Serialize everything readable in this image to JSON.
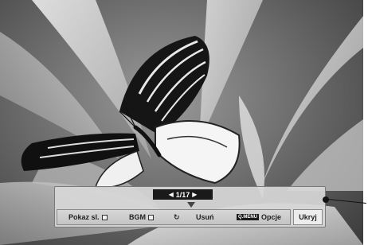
{
  "osd": {
    "page_counter": "1/17",
    "prev_arrow": "◀",
    "next_arrow": "▶",
    "buttons": {
      "slideshow": "Pokaz sl.",
      "bgm": "BGM",
      "rotate_icon": "↻",
      "delete": "Usuń",
      "qmenu_tag": "Q.MENU",
      "options": "Opcje",
      "hide": "Ukryj"
    }
  },
  "icons": {
    "slideshow": "square-icon",
    "bgm": "square-icon",
    "rotate": "rotate-icon",
    "marker": "triangle-down-icon",
    "callout": "callout-dot-icon"
  }
}
